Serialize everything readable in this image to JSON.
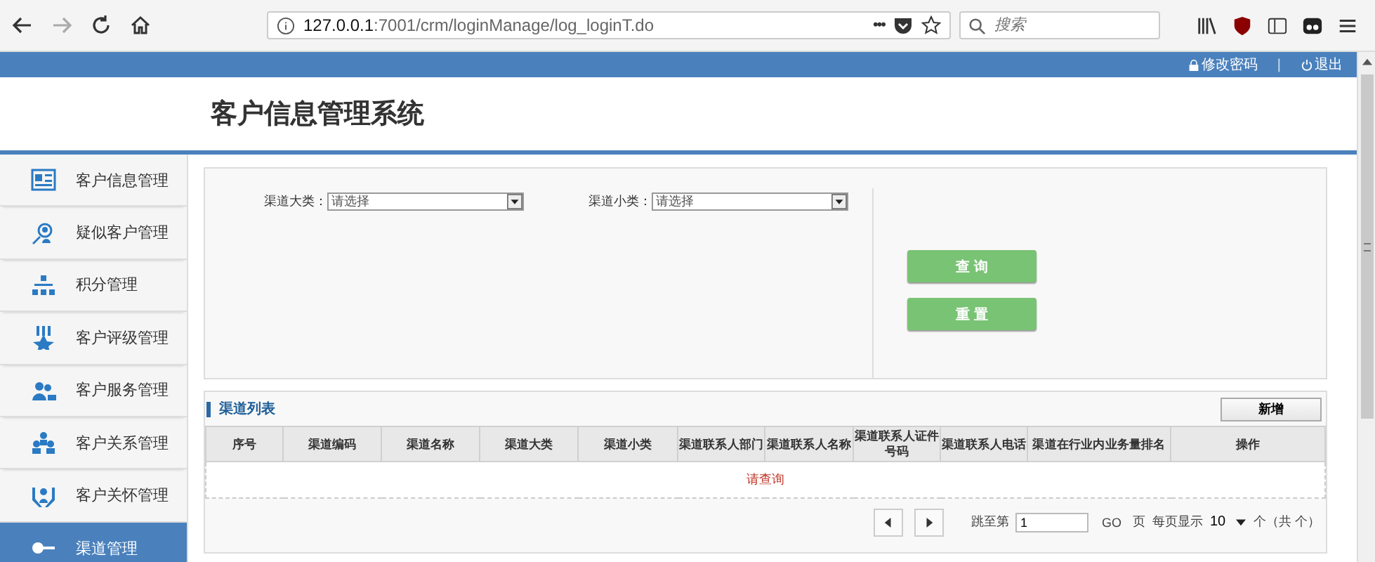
{
  "browser": {
    "url_host": "127.0.0.1",
    "url_path": ":7001/crm/loginManage/log_loginT.do",
    "url_menu": "•••",
    "search_placeholder": "搜索"
  },
  "topbar": {
    "links": [
      "修改密码",
      "退出"
    ],
    "separator": "|"
  },
  "header": {
    "title": "客户信息管理系统"
  },
  "sidebar": {
    "items": [
      {
        "label": "客户信息管理",
        "selected": false
      },
      {
        "label": "疑似客户管理",
        "selected": false
      },
      {
        "label": "积分管理",
        "selected": false
      },
      {
        "label": "客户评级管理",
        "selected": false
      },
      {
        "label": "客户服务管理",
        "selected": false
      },
      {
        "label": "客户关系管理",
        "selected": false
      },
      {
        "label": "客户关怀管理",
        "selected": false
      },
      {
        "label": "渠道管理",
        "selected": true
      }
    ]
  },
  "filters": [
    {
      "label": "渠道大类：",
      "placeholder": "请选择"
    },
    {
      "label": "渠道小类：",
      "placeholder": "请选择"
    }
  ],
  "actions": [
    "查 询",
    "重 置"
  ],
  "list": {
    "title": "渠道列表",
    "add_button": "新增",
    "columns": [
      "序号",
      "渠道编码",
      "渠道名称",
      "渠道大类",
      "渠道小类",
      "渠道联系人部门",
      "渠道联系人名称",
      "渠道联系人证件号码",
      "渠道联系人电话",
      "渠道在行业内业务量排名",
      "操作"
    ],
    "empty_message": "请查询"
  },
  "pagination": {
    "goto_label": "跳至第",
    "page_value": "1",
    "go": "GO",
    "page_unit": "页",
    "per_page_label": "每页显示",
    "per_page": "10",
    "total": "个（共 个）"
  }
}
